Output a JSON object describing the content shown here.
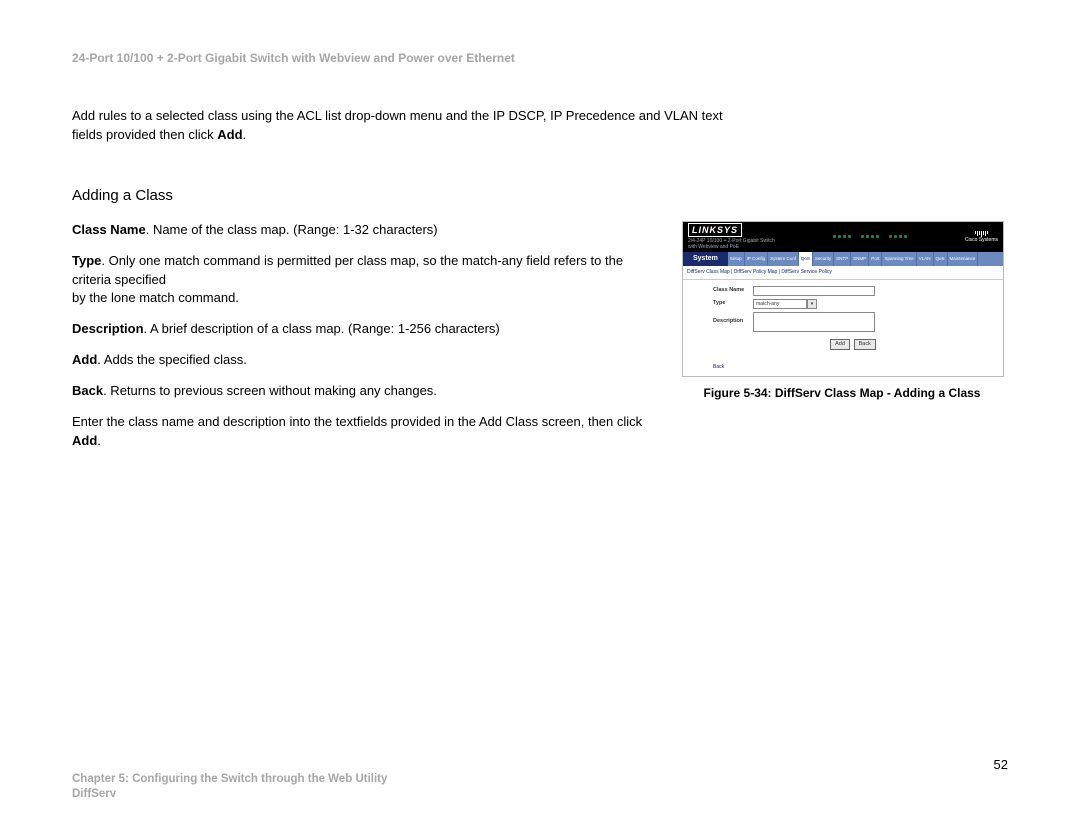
{
  "header": {
    "product_title": "24-Port 10/100 + 2-Port Gigabit Switch with Webview and Power over Ethernet"
  },
  "intro": {
    "line1": "Add rules to a selected class using the ACL list drop-down menu and the IP DSCP, IP Precedence and VLAN text",
    "line2_pre": "fields provided then click ",
    "line2_bold": "Add",
    "line2_post": "."
  },
  "section": {
    "heading": "Adding a Class"
  },
  "defs": {
    "class_name": {
      "term": "Class Name",
      "text": ". Name of the class map. (Range: 1-32 characters)"
    },
    "type": {
      "term": "Type",
      "text1": ". Only one match command is permitted per class map, so the match-any field refers to the criteria specified",
      "text2": "by the lone match command."
    },
    "description": {
      "term": "Description",
      "text": ". A brief description of a class map. (Range: 1-256 characters)"
    },
    "add": {
      "term": "Add",
      "text": ". Adds the specified class."
    },
    "back": {
      "term": "Back",
      "text": ". Returns to previous screen without making any changes."
    },
    "enter": {
      "pre": "Enter the class name and description into the textfields provided in the Add Class screen, then click ",
      "bold": "Add",
      "post": "."
    }
  },
  "figure": {
    "caption": "Figure 5-34: DiffServ Class Map - Adding a Class",
    "logo": "LINKSYS",
    "cisco": "Cisco Systems",
    "subhead1": "2/4-24P 10/100 + 2-Port Gigabit Switch",
    "subhead2": "with Webview and PoE",
    "nav_left": "System",
    "top_tabs": [
      "Setup",
      "IP Config",
      "System Conf",
      "QoS",
      "Security",
      "SNTP",
      "SNMP",
      "Port",
      "Spanning Tree",
      "VLAN",
      "QoS",
      "Maintenance"
    ],
    "subtabs": "DiffServ Class Map | DiffServ Policy Map | DiffServ Service Policy",
    "form": {
      "class_name_label": "Class Name",
      "type_label": "Type",
      "type_value": "match-any",
      "desc_label": "Description",
      "btn_add": "Add",
      "btn_back": "Back",
      "back_link": "Back"
    }
  },
  "page_number": "52",
  "footer": {
    "line1": "Chapter 5: Configuring the Switch through the Web Utility",
    "line2": "DiffServ"
  }
}
